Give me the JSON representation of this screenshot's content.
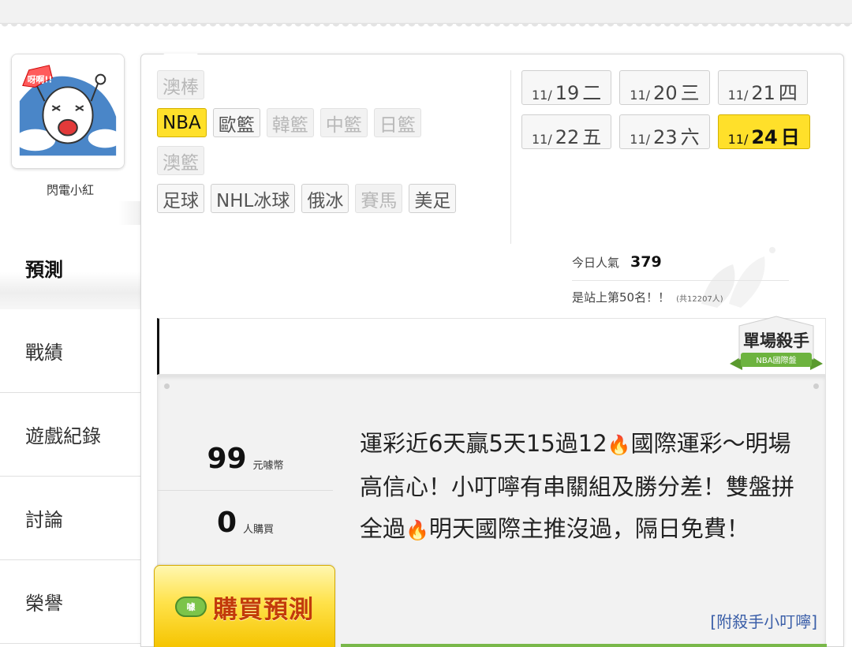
{
  "sidebar": {
    "user_name": "閃電小紅",
    "avatar_caption": "呀啊!!",
    "menu": [
      {
        "label": "預測",
        "active": true
      },
      {
        "label": "戰績",
        "active": false
      },
      {
        "label": "遊戲紀錄",
        "active": false
      },
      {
        "label": "討論",
        "active": false
      },
      {
        "label": "榮譽",
        "active": false
      }
    ]
  },
  "leagues": [
    [
      {
        "label": "澳棒",
        "state": "disabled"
      }
    ],
    [
      {
        "label": "NBA",
        "state": "active"
      },
      {
        "label": "歐籃",
        "state": "normal"
      },
      {
        "label": "韓籃",
        "state": "disabled"
      },
      {
        "label": "中籃",
        "state": "disabled"
      },
      {
        "label": "日籃",
        "state": "disabled"
      }
    ],
    [
      {
        "label": "澳籃",
        "state": "disabled"
      }
    ],
    [
      {
        "label": "足球",
        "state": "normal"
      },
      {
        "label": "NHL冰球",
        "state": "normal"
      },
      {
        "label": "俄冰",
        "state": "normal"
      },
      {
        "label": "賽馬",
        "state": "disabled"
      },
      {
        "label": "美足",
        "state": "normal"
      }
    ]
  ],
  "dates": [
    [
      {
        "month": "11/",
        "day": "19",
        "weekday": "二",
        "active": false
      },
      {
        "month": "11/",
        "day": "20",
        "weekday": "三",
        "active": false
      },
      {
        "month": "11/",
        "day": "21",
        "weekday": "四",
        "active": false
      }
    ],
    [
      {
        "month": "11/",
        "day": "22",
        "weekday": "五",
        "active": false
      },
      {
        "month": "11/",
        "day": "23",
        "weekday": "六",
        "active": false
      },
      {
        "month": "11/",
        "day": "24",
        "weekday": "日",
        "active": true
      }
    ]
  ],
  "popularity": {
    "label": "今日人氣",
    "count": "379",
    "rank_text": "是站上第50名！！",
    "total_text": "(共12207人)"
  },
  "badge": {
    "title": "單場殺手",
    "subtitle": "NBA國際盤"
  },
  "prediction": {
    "price": "99",
    "price_unit": "元噱幣",
    "buyers": "0",
    "buyers_unit": "人購買",
    "buy_label": "購買預測",
    "buy_icon_text": "噱",
    "description_parts": [
      "運彩近6天贏5天15過12",
      "國際運彩～明場高信心！小叮嚀有串關組及勝分差！雙盤拼全過",
      "明天國際主推沒過，隔日免費！"
    ],
    "link_text": "[附殺手小叮嚀]"
  },
  "colors": {
    "highlight": "#ffe02a",
    "link": "#3a5ea8",
    "flame": "#ff6a00",
    "progress": "#79b84a"
  }
}
